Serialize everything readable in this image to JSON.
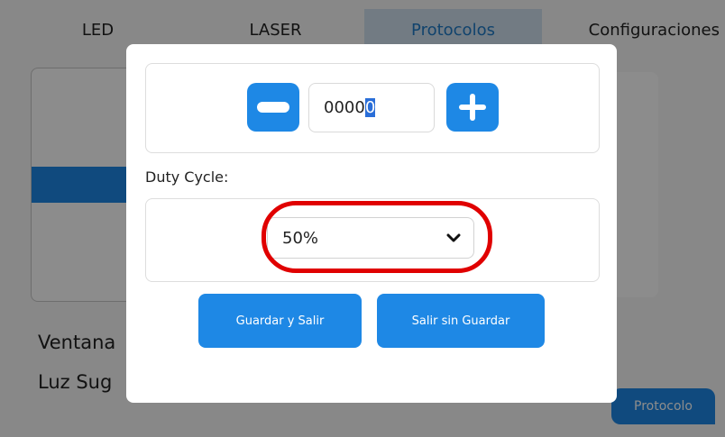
{
  "tabs": [
    {
      "label": "LED"
    },
    {
      "label": "LASER"
    },
    {
      "label": "Protocolos"
    },
    {
      "label": "Configuraciones"
    }
  ],
  "background": {
    "text_line_1": "Ventana",
    "text_line_2": "Luz Sug",
    "side_glyph": "\\",
    "protocol_button": "Protocolo"
  },
  "dialog": {
    "stepper": {
      "value_prefix": "0000",
      "value_selected": "0",
      "minus_icon": "minus-icon",
      "plus_icon": "plus-icon"
    },
    "duty_cycle": {
      "label": "Duty Cycle:",
      "selected": "50%",
      "chevron_icon": "chevron-down-icon"
    },
    "buttons": {
      "save_exit": "Guardar y Salir",
      "exit_no_save": "Salir sin Guardar"
    }
  },
  "colors": {
    "accent": "#1e88e5",
    "highlight_ring": "#e00000",
    "active_tab_bg": "#cfe0ee"
  }
}
